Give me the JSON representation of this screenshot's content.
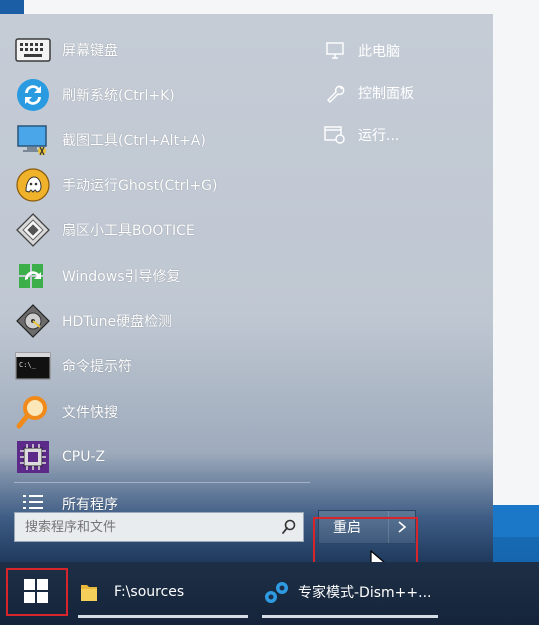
{
  "start_menu": {
    "items": [
      {
        "label": "屏幕键盘",
        "icon": "keyboard-icon"
      },
      {
        "label": "刷新系统(Ctrl+K)",
        "icon": "refresh-icon"
      },
      {
        "label": "截图工具(Ctrl+Alt+A)",
        "icon": "screenshot-icon"
      },
      {
        "label": "手动运行Ghost(Ctrl+G)",
        "icon": "ghost-icon"
      },
      {
        "label": "扇区小工具BOOTICE",
        "icon": "disk-tool-icon"
      },
      {
        "label": "Windows引导修复",
        "icon": "boot-repair-icon"
      },
      {
        "label": "HDTune硬盘检测",
        "icon": "hard-disk-icon"
      },
      {
        "label": "命令提示符",
        "icon": "command-prompt-icon"
      },
      {
        "label": "文件快搜",
        "icon": "magnifier-icon"
      },
      {
        "label": "CPU-Z",
        "icon": "cpu-icon"
      },
      {
        "label": "所有程序",
        "icon": "all-programs-icon"
      }
    ],
    "right_items": [
      {
        "label": "此电脑",
        "icon": "computer-icon"
      },
      {
        "label": "控制面板",
        "icon": "wrench-icon"
      },
      {
        "label": "运行...",
        "icon": "run-icon"
      }
    ],
    "search": {
      "placeholder": "搜索程序和文件"
    },
    "restart_label": "重启"
  },
  "taskbar": {
    "items": [
      {
        "label": "F:\\sources",
        "icon": "folder-icon"
      },
      {
        "label": "专家模式-Dism++...",
        "icon": "gears-icon"
      }
    ]
  },
  "colors": {
    "accent": "#d6262b",
    "taskbar": "#1d2f46",
    "restart_button": "#4b6688"
  }
}
